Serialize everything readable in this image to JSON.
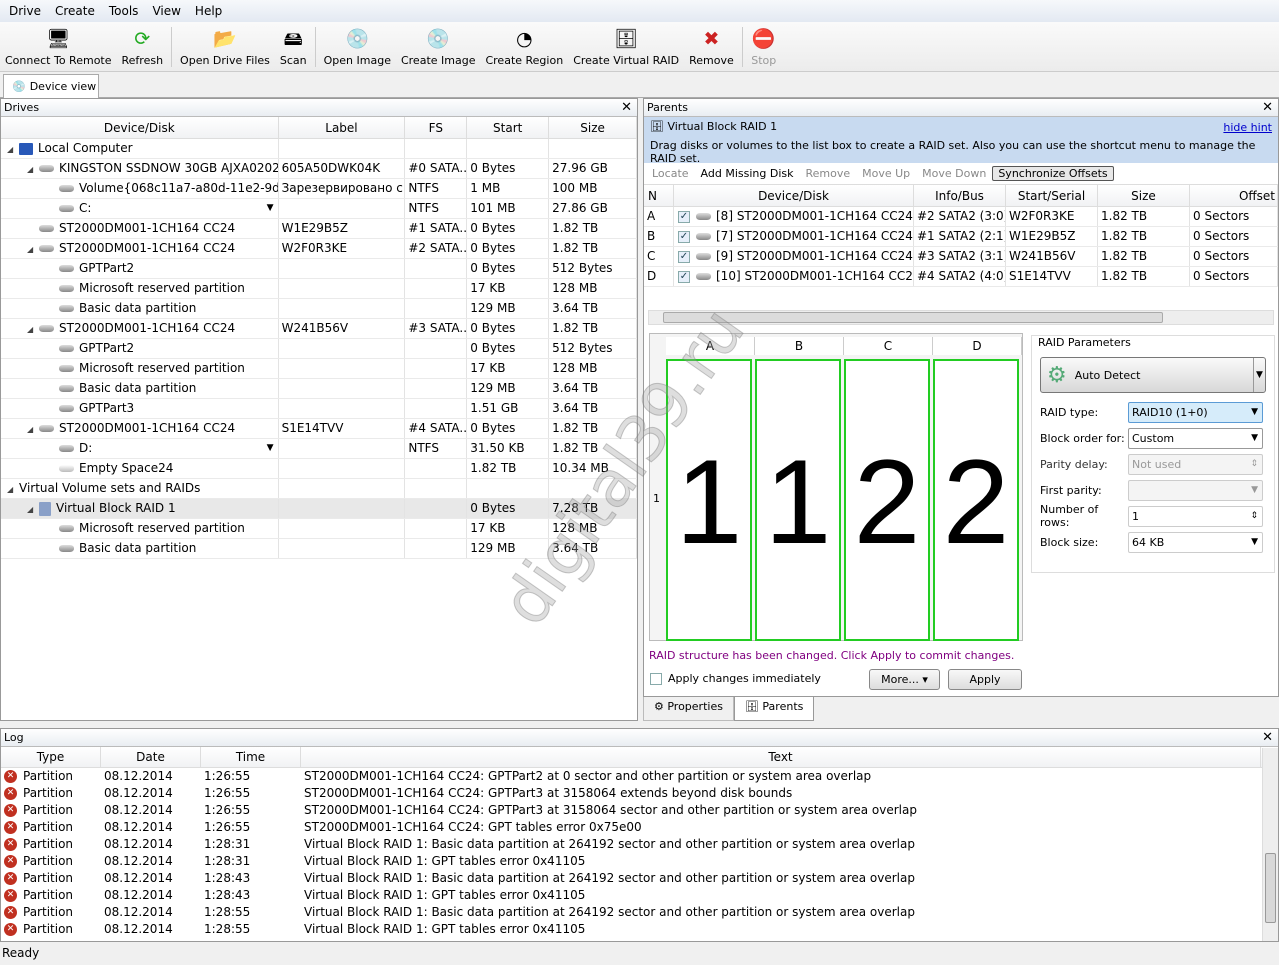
{
  "menu": [
    "Drive",
    "Create",
    "Tools",
    "View",
    "Help"
  ],
  "toolbar": [
    {
      "label": "Connect To Remote",
      "icon": "computer-network-icon",
      "glyph": "🖥"
    },
    {
      "label": "Refresh",
      "icon": "refresh-icon",
      "glyph": "⟳"
    },
    {
      "label": "Open Drive Files",
      "icon": "folder-icon",
      "glyph": "📂"
    },
    {
      "label": "Scan",
      "icon": "scan-icon",
      "glyph": "🖴"
    },
    {
      "label": "Open Image",
      "icon": "open-image-icon",
      "glyph": "💿"
    },
    {
      "label": "Create Image",
      "icon": "create-image-icon",
      "glyph": "💿"
    },
    {
      "label": "Create Region",
      "icon": "create-region-icon",
      "glyph": "◔"
    },
    {
      "label": "Create Virtual RAID",
      "icon": "raid-icon",
      "glyph": "🗄"
    },
    {
      "label": "Remove",
      "icon": "remove-icon",
      "glyph": "✖"
    },
    {
      "label": "Stop",
      "icon": "stop-icon",
      "glyph": "⛔"
    }
  ],
  "tab": "Device view",
  "drives": {
    "title": "Drives",
    "columns": [
      "Device/Disk",
      "Label",
      "FS",
      "Start",
      "Size"
    ],
    "rows": [
      {
        "name": "Local Computer",
        "level": 0,
        "expand": true,
        "icon": "computer",
        "label": "",
        "fs": "",
        "start": "",
        "size": ""
      },
      {
        "name": "KINGSTON SSDNOW 30GB AJXA0202",
        "level": 1,
        "expand": true,
        "icon": "disk",
        "label": "605A50DWK04K",
        "fs": "#0 SATA...",
        "start": "0 Bytes",
        "size": "27.96 GB"
      },
      {
        "name": "Volume{068c11a7-a80d-11e2-9d95",
        "level": 2,
        "dropdown": true,
        "icon": "disk",
        "label": "Зарезервировано с...",
        "fs": "NTFS",
        "start": "1 MB",
        "size": "100 MB"
      },
      {
        "name": "C:",
        "level": 2,
        "dropdown": true,
        "icon": "disk",
        "label": "",
        "fs": "NTFS",
        "start": "101 MB",
        "size": "27.86 GB"
      },
      {
        "name": "ST2000DM001-1CH164 CC24",
        "level": 1,
        "icon": "disk",
        "label": "W1E29B5Z",
        "fs": "#1 SATA...",
        "start": "0 Bytes",
        "size": "1.82 TB"
      },
      {
        "name": "ST2000DM001-1CH164 CC24",
        "level": 1,
        "expand": true,
        "icon": "disk",
        "label": "W2F0R3KE",
        "fs": "#2 SATA...",
        "start": "0 Bytes",
        "size": "1.82 TB"
      },
      {
        "name": "GPTPart2",
        "level": 2,
        "icon": "disk",
        "label": "",
        "fs": "",
        "start": "0 Bytes",
        "size": "512 Bytes"
      },
      {
        "name": "Microsoft reserved partition",
        "level": 2,
        "icon": "disk",
        "label": "",
        "fs": "",
        "start": "17 KB",
        "size": "128 MB"
      },
      {
        "name": "Basic data partition",
        "level": 2,
        "icon": "disk",
        "label": "",
        "fs": "",
        "start": "129 MB",
        "size": "3.64 TB"
      },
      {
        "name": "ST2000DM001-1CH164 CC24",
        "level": 1,
        "expand": true,
        "icon": "disk",
        "label": "W241B56V",
        "fs": "#3 SATA...",
        "start": "0 Bytes",
        "size": "1.82 TB"
      },
      {
        "name": "GPTPart2",
        "level": 2,
        "icon": "disk",
        "label": "",
        "fs": "",
        "start": "0 Bytes",
        "size": "512 Bytes"
      },
      {
        "name": "Microsoft reserved partition",
        "level": 2,
        "icon": "disk",
        "label": "",
        "fs": "",
        "start": "17 KB",
        "size": "128 MB"
      },
      {
        "name": "Basic data partition",
        "level": 2,
        "icon": "disk",
        "label": "",
        "fs": "",
        "start": "129 MB",
        "size": "3.64 TB"
      },
      {
        "name": "GPTPart3",
        "level": 2,
        "icon": "disk",
        "label": "",
        "fs": "",
        "start": "1.51 GB",
        "size": "3.64 TB"
      },
      {
        "name": "ST2000DM001-1CH164 CC24",
        "level": 1,
        "expand": true,
        "icon": "disk",
        "label": "S1E14TVV",
        "fs": "#4 SATA...",
        "start": "0 Bytes",
        "size": "1.82 TB"
      },
      {
        "name": "D:",
        "level": 2,
        "dropdown": true,
        "icon": "disk",
        "label": "",
        "fs": "NTFS",
        "start": "31.50 KB",
        "size": "1.82 TB"
      },
      {
        "name": "Empty Space24",
        "level": 2,
        "icon": "empty",
        "label": "",
        "fs": "",
        "start": "1.82 TB",
        "size": "10.34 MB"
      },
      {
        "name": "Virtual Volume sets and RAIDs",
        "level": 0,
        "expand": true,
        "icon": "none",
        "label": "",
        "fs": "",
        "start": "",
        "size": ""
      },
      {
        "name": "Virtual Block RAID 1",
        "level": 1,
        "expand": true,
        "icon": "raid",
        "label": "",
        "fs": "",
        "start": "0 Bytes",
        "size": "7.28 TB",
        "selected": true
      },
      {
        "name": "Microsoft reserved partition",
        "level": 2,
        "icon": "disk",
        "label": "",
        "fs": "",
        "start": "17 KB",
        "size": "128 MB"
      },
      {
        "name": "Basic data partition",
        "level": 2,
        "icon": "disk",
        "label": "",
        "fs": "",
        "start": "129 MB",
        "size": "3.64 TB"
      }
    ]
  },
  "parents": {
    "title": "Parents",
    "hint_title": "Virtual Block RAID 1",
    "hide_hint": "hide hint",
    "hint_text": "Drag disks or volumes to the list box to create a RAID set. Also you can use the shortcut menu to manage the RAID set.",
    "tools": {
      "locate": "Locate",
      "add_missing": "Add Missing Disk",
      "remove": "Remove",
      "move_up": "Move Up",
      "move_down": "Move Down",
      "sync": "Synchronize Offsets"
    },
    "columns": [
      "N",
      "Device/Disk",
      "Info/Bus",
      "Start/Serial",
      "Size",
      "Offset"
    ],
    "rows": [
      {
        "n": "A",
        "checked": true,
        "device": "[8] ST2000DM001-1CH164 CC24",
        "bus": "#2 SATA2 (3:0)",
        "serial": "W2F0R3KE",
        "size": "1.82 TB",
        "offset": "0 Sectors"
      },
      {
        "n": "B",
        "checked": true,
        "device": "[7] ST2000DM001-1CH164 CC24",
        "bus": "#1 SATA2 (2:1)",
        "serial": "W1E29B5Z",
        "size": "1.82 TB",
        "offset": "0 Sectors"
      },
      {
        "n": "C",
        "checked": true,
        "device": "[9] ST2000DM001-1CH164 CC24",
        "bus": "#3 SATA2 (3:1)",
        "serial": "W241B56V",
        "size": "1.82 TB",
        "offset": "0 Sectors"
      },
      {
        "n": "D",
        "checked": true,
        "device": "[10] ST2000DM001-1CH164 CC24",
        "bus": "#4 SATA2 (4:0)",
        "serial": "S1E14TVV",
        "size": "1.82 TB",
        "offset": "0 Sectors"
      }
    ],
    "grid": {
      "columns": [
        "A",
        "B",
        "C",
        "D"
      ],
      "row_label": "1",
      "cells": [
        "1",
        "1",
        "2",
        "2"
      ],
      "border_color": "#22cc22"
    },
    "params": {
      "title": "RAID Parameters",
      "auto_detect": "Auto Detect",
      "raid_type_label": "RAID type:",
      "raid_type": "RAID10 (1+0)",
      "block_order_label": "Block order for:",
      "block_order": "Custom",
      "parity_delay_label": "Parity delay:",
      "parity_delay": "Not used",
      "first_parity_label": "First parity:",
      "first_parity": "",
      "rows_label": "Number of rows:",
      "rows": "1",
      "block_size_label": "Block size:",
      "block_size": "64 KB"
    },
    "changed_msg": "RAID structure has been changed. Click Apply to commit changes.",
    "changed_color": "#800080",
    "apply_immediately": "Apply changes immediately",
    "more": "More...",
    "apply": "Apply",
    "tabs": [
      "Properties",
      "Parents"
    ]
  },
  "log": {
    "title": "Log",
    "columns": [
      "Type",
      "Date",
      "Time",
      "Text"
    ],
    "rows": [
      {
        "type": "Partition",
        "date": "08.12.2014",
        "time": "1:26:55",
        "text": "ST2000DM001-1CH164 CC24: GPTPart2 at 0 sector and other partition or system area overlap"
      },
      {
        "type": "Partition",
        "date": "08.12.2014",
        "time": "1:26:55",
        "text": "ST2000DM001-1CH164 CC24: GPTPart3 at 3158064 extends beyond disk bounds"
      },
      {
        "type": "Partition",
        "date": "08.12.2014",
        "time": "1:26:55",
        "text": "ST2000DM001-1CH164 CC24: GPTPart3 at 3158064 sector and other partition or system area overlap"
      },
      {
        "type": "Partition",
        "date": "08.12.2014",
        "time": "1:26:55",
        "text": "ST2000DM001-1CH164 CC24: GPT tables error 0x75e00"
      },
      {
        "type": "Partition",
        "date": "08.12.2014",
        "time": "1:28:31",
        "text": "Virtual Block RAID 1: Basic data partition at 264192 sector and other partition or system area overlap"
      },
      {
        "type": "Partition",
        "date": "08.12.2014",
        "time": "1:28:31",
        "text": "Virtual Block RAID 1: GPT tables error 0x41105"
      },
      {
        "type": "Partition",
        "date": "08.12.2014",
        "time": "1:28:43",
        "text": "Virtual Block RAID 1: Basic data partition at 264192 sector and other partition or system area overlap"
      },
      {
        "type": "Partition",
        "date": "08.12.2014",
        "time": "1:28:43",
        "text": "Virtual Block RAID 1: GPT tables error 0x41105"
      },
      {
        "type": "Partition",
        "date": "08.12.2014",
        "time": "1:28:55",
        "text": "Virtual Block RAID 1: Basic data partition at 264192 sector and other partition or system area overlap"
      },
      {
        "type": "Partition",
        "date": "08.12.2014",
        "time": "1:28:55",
        "text": "Virtual Block RAID 1: GPT tables error 0x41105"
      }
    ]
  },
  "status": "Ready",
  "watermark": "digital39.ru"
}
